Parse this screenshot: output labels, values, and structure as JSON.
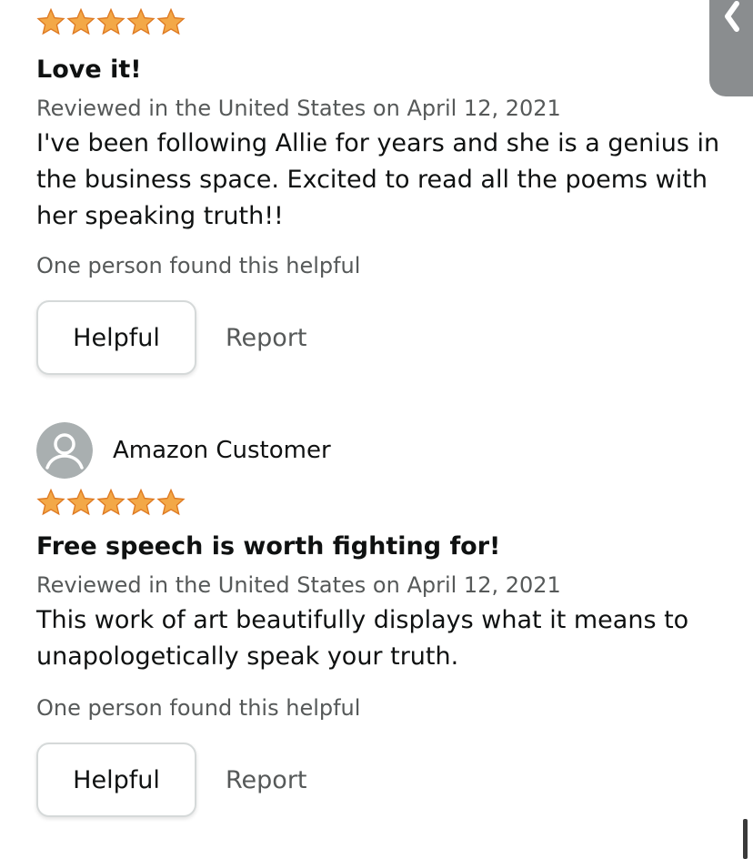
{
  "reviews": [
    {
      "rating": 5,
      "title": "Love it!",
      "meta": "Reviewed in the United States on April 12, 2021",
      "body": "I've been following Allie for years and she is a genius in the business space. Excited to read all the poems with her speaking truth!!",
      "helpful_count": "One person found this helpful",
      "helpful_label": "Helpful",
      "report_label": "Report"
    },
    {
      "reviewer": "Amazon Customer",
      "rating": 5,
      "title": "Free speech is worth fighting for!",
      "meta": "Reviewed in the United States on April 12, 2021",
      "body": "This work of art beautifully displays what it means to unapologetically speak your truth.",
      "helpful_count": "One person found this helpful",
      "helpful_label": "Helpful",
      "report_label": "Report"
    }
  ],
  "colors": {
    "star": "#f3a847",
    "star_stroke": "#de7921",
    "meta_text": "#565959",
    "avatar_bg": "#a9afb0",
    "side_tab": "#8a8d8f"
  },
  "icons": {
    "star": "star-icon",
    "avatar": "person-avatar-icon",
    "side_tab": "chevron-left-icon"
  }
}
